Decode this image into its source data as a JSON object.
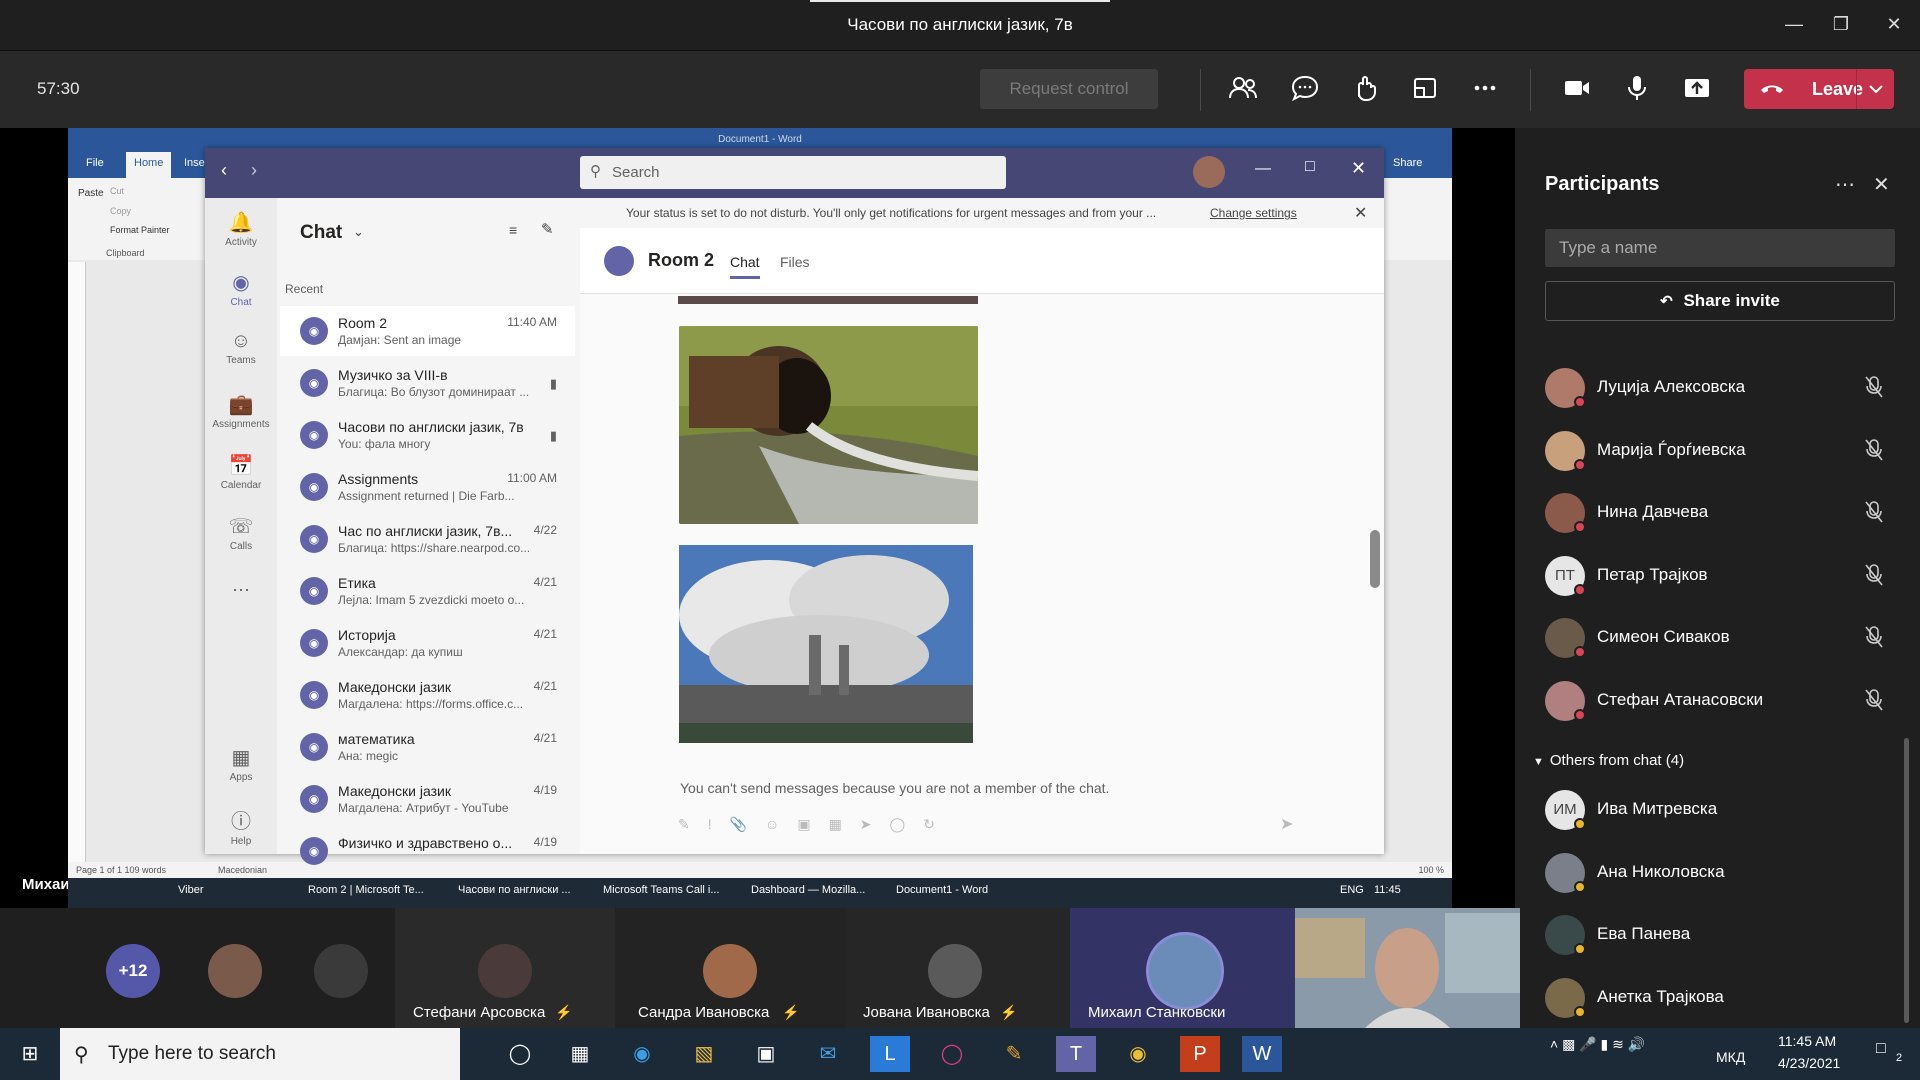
{
  "window": {
    "title": "Часови по англиски јазик, 7в"
  },
  "meeting_bar": {
    "timer": "57:30",
    "request_control": "Request control",
    "leave": "Leave"
  },
  "shared_screen": {
    "word": {
      "title": "Document1 - Word",
      "tabs": [
        "File",
        "Home",
        "Inser"
      ],
      "share": "Share",
      "clipboard": {
        "paste": "Paste",
        "cut": "Cut",
        "copy": "Copy",
        "format_painter": "Format Painter",
        "group": "Clipboard"
      },
      "status_left": "Page 1 of 1    109 words",
      "status_lang": "Macedonian",
      "zoom": "100 %"
    },
    "presenter_label": "Михаил Станковски",
    "teams": {
      "search_placeholder": "Search",
      "rail": [
        {
          "label": "Activity"
        },
        {
          "label": "Chat"
        },
        {
          "label": "Teams"
        },
        {
          "label": "Assignments"
        },
        {
          "label": "Calendar"
        },
        {
          "label": "Calls"
        },
        {
          "label": "Apps"
        },
        {
          "label": "Help"
        }
      ],
      "chat_header": "Chat",
      "recent_label": "Recent",
      "chats": [
        {
          "name": "Room 2",
          "preview": "Дамјан: Sent an image",
          "time": "11:40 AM"
        },
        {
          "name": "Музичко за VIII-в",
          "preview": "Благица: Во блузот доминираат ...",
          "time": ""
        },
        {
          "name": "Часови по англиски јазик, 7в",
          "preview": "You: фала многу",
          "time": ""
        },
        {
          "name": "Assignments",
          "preview": "Assignment returned | Die Farb...",
          "time": "11:00 AM"
        },
        {
          "name": "Час по англиски јазик, 7в...",
          "preview": "Благица: https://share.nearpod.co...",
          "time": "4/22"
        },
        {
          "name": "Етика",
          "preview": "Лејла: Imam 5 zvezdicki moeto o...",
          "time": "4/21"
        },
        {
          "name": "Историја",
          "preview": "Александар: да купиш",
          "time": "4/21"
        },
        {
          "name": "Македонски јазик",
          "preview": "Магдалена: https://forms.office.c...",
          "time": "4/21"
        },
        {
          "name": "математика",
          "preview": "Ана: megic",
          "time": "4/21"
        },
        {
          "name": "Македонски јазик",
          "preview": "Магдалена: Атрибут - YouTube",
          "time": "4/19"
        },
        {
          "name": "Физичко и здравствено о...",
          "preview": "",
          "time": "4/19"
        }
      ],
      "dnd_text": "Your status is set to do not disturb. You'll only get notifications for urgent messages and from your ...",
      "dnd_link": "Change settings",
      "room_title": "Room 2",
      "room_tabs": [
        "Chat",
        "Files"
      ],
      "cannot_send": "You can't send messages because you are not a member of the chat."
    },
    "inner_taskbar": [
      "Viber",
      "Room 2 | Microsoft Te...",
      "Часови по англиски ...",
      "Microsoft Teams Call i...",
      "Dashboard — Mozilla...",
      "Document1 - Word"
    ],
    "inner_tray": {
      "lang": "ENG",
      "time": "11:45"
    }
  },
  "participants": {
    "title": "Participants",
    "search_placeholder": "Type a name",
    "share_invite": "Share invite",
    "list": [
      {
        "name": "Луција Алексовска",
        "initials": "",
        "color": "#b07a6a"
      },
      {
        "name": "Марија Ѓорѓиевска",
        "initials": "",
        "color": "#c9a07c"
      },
      {
        "name": "Нина Давчева",
        "initials": "",
        "color": "#8c5a4a"
      },
      {
        "name": "Петар Трајков",
        "initials": "ПТ",
        "color": "#e6e6e6"
      },
      {
        "name": "Симеон Сиваков",
        "initials": "",
        "color": "#6a5a4a"
      },
      {
        "name": "Стефан Атанасовски",
        "initials": "",
        "color": "#b08080"
      }
    ],
    "others_label": "Others from chat (4)",
    "others": [
      {
        "name": "Ива Митревска",
        "initials": "ИМ",
        "color": "#e6e6e6"
      },
      {
        "name": "Ана Николовска",
        "initials": "",
        "color": "#7a7f8a"
      },
      {
        "name": "Ева Панева",
        "initials": "",
        "color": "#3a4a4a"
      },
      {
        "name": "Анетка Трајкова",
        "initials": "",
        "color": "#7a6a4a"
      }
    ]
  },
  "gallery": {
    "overflow": "+12",
    "tiles": [
      {
        "name": "Стефани Арсовска"
      },
      {
        "name": "Сандра Ивановска"
      },
      {
        "name": "Јована Ивановска"
      },
      {
        "name": "Михаил Станковски"
      }
    ]
  },
  "taskbar": {
    "search_placeholder": "Type here to search",
    "time": "11:45 AM",
    "date": "4/23/2021",
    "lang": "МКД",
    "notif": "2"
  }
}
